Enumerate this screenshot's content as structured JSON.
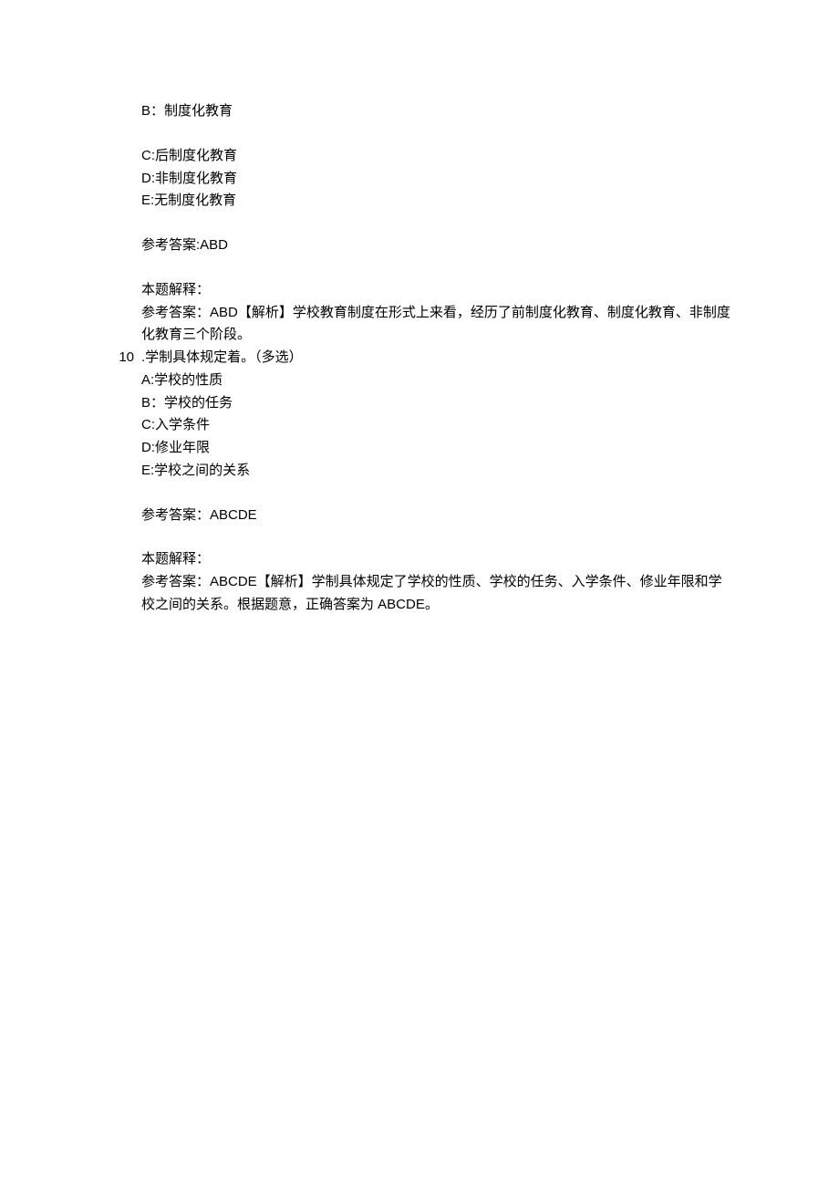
{
  "q9": {
    "optB": "B：制度化教育",
    "optC": "C:后制度化教育",
    "optD": "D:非制度化教育",
    "optE": "E:无制度化教育",
    "answerLabel": "参考答案:ABD",
    "expLabel": "本题解释：",
    "expText": "参考答案：ABD【解析】学校教育制度在形式上来看，经历了前制度化教育、制度化教育、非制度化教育三个阶段。"
  },
  "q10": {
    "number": "10",
    "question": ".学制具体规定着。（多选）",
    "optA": "A:学校的性质",
    "optB": "B：学校的任务",
    "optC": "C:入学条件",
    "optD": "D:修业年限",
    "optE": "E:学校之间的关系",
    "answerLabel": "参考答案：ABCDE",
    "expLabel": "本题解释：",
    "expText": "参考答案：ABCDE【解析】学制具体规定了学校的性质、学校的任务、入学条件、修业年限和学校之间的关系。根据题意，正确答案为 ABCDE。"
  }
}
